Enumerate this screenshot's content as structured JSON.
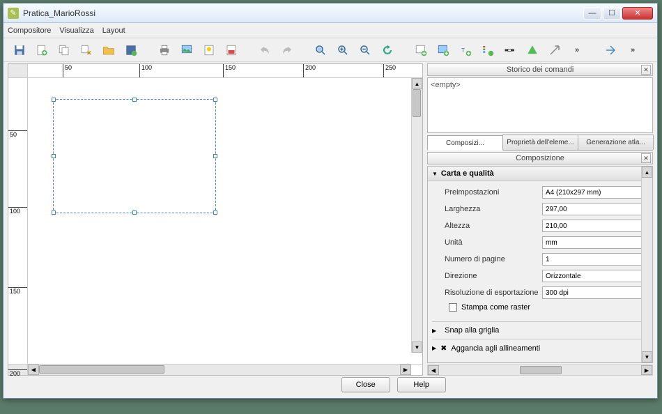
{
  "title": "Pratica_MarioRossi",
  "menu": {
    "compositore": "Compositore",
    "visualizza": "Visualizza",
    "layout": "Layout"
  },
  "ruler_h": [
    "50",
    "100",
    "150",
    "200",
    "250"
  ],
  "ruler_v": [
    "50",
    "100",
    "150",
    "200"
  ],
  "history_panel_title": "Storico dei comandi",
  "history_empty": "<empty>",
  "tabs": {
    "comp": "Composizi...",
    "elem": "Proprietà dell'eleme...",
    "atlas": "Generazione atla..."
  },
  "comp_panel_title": "Composizione",
  "section_paper": "Carta e qualità",
  "fields": {
    "preset_label": "Preimpostazioni",
    "preset_value": "A4 (210x297 mm)",
    "width_label": "Larghezza",
    "width_value": "297,00",
    "height_label": "Altezza",
    "height_value": "210,00",
    "units_label": "Unità",
    "units_value": "mm",
    "pages_label": "Numero di pagine",
    "pages_value": "1",
    "dir_label": "Direzione",
    "dir_value": "Orizzontale",
    "res_label": "Risoluzione di esportazione",
    "res_value": "300 dpi",
    "raster_label": "Stampa come raster",
    "snap_label": "Snap alla griglia",
    "align_label": "Aggancia agli allineamenti"
  },
  "buttons": {
    "close": "Close",
    "help": "Help"
  }
}
